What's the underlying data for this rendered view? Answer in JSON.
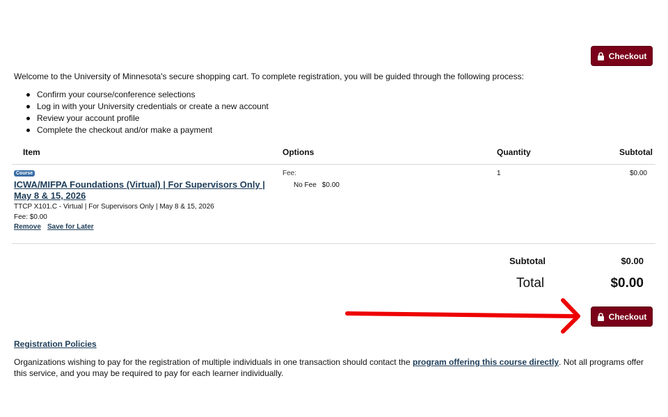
{
  "checkout_button_label": "Checkout",
  "intro_text": "Welcome to the University of Minnesota's secure shopping cart. To complete registration, you will be guided through the following process:",
  "steps": [
    "Confirm your course/conference selections",
    "Log in with your University credentials or create a new account",
    "Review your account profile",
    "Complete the checkout and/or make a payment"
  ],
  "table": {
    "headers": {
      "item": "Item",
      "options": "Options",
      "quantity": "Quantity",
      "subtotal": "Subtotal"
    },
    "row": {
      "badge": "Course",
      "title": "ICWA/MIFPA Foundations (Virtual) | For Supervisors Only | May 8 & 15, 2026",
      "meta": "TTCP X101.C - Virtual | For Supervisors Only | May 8 & 15, 2026",
      "fee": "Fee: $0.00",
      "remove_label": "Remove",
      "save_label": "Save for Later",
      "option_label": "Fee:",
      "option_name": "No Fee",
      "option_price": "$0.00",
      "quantity": "1",
      "subtotal": "$0.00"
    }
  },
  "summary": {
    "subtotal_label": "Subtotal",
    "subtotal_value": "$0.00",
    "total_label": "Total",
    "total_value": "$0.00"
  },
  "policies_link": "Registration Policies",
  "org_note": {
    "before": "Organizations wishing to pay for the registration of multiple individuals in one transaction should contact the ",
    "link": "program offering this course directly",
    "after": ".  Not all programs offer this service, and you may be required to pay for each learner individually."
  },
  "colors": {
    "brand": "#7a0019",
    "link": "#1e3d59",
    "badge": "#3a6ea5",
    "arrow": "#ee0000"
  }
}
